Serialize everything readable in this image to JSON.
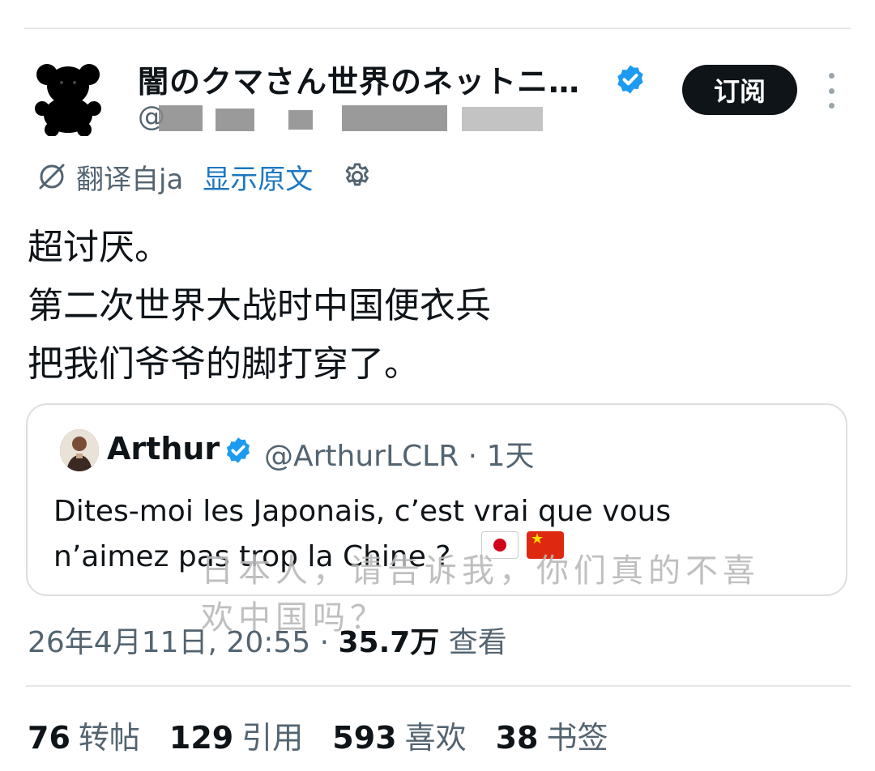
{
  "author": {
    "display_name": "闇のクマさん世界のネットニ…",
    "handle": "@",
    "subscribe_label": "订阅"
  },
  "translation": {
    "label": "翻译自ja",
    "show_original": "显示原文"
  },
  "post": {
    "text": "超讨厌。\n第二次世界大战时中国便衣兵\n把我们爷爷的脚打穿了。"
  },
  "quote": {
    "name": "Arthur",
    "meta": "@ArthurLCLR · 1天",
    "text": "Dites-moi les Japonais, c’est vrai que vous\nn’aimez pas trop la Chine ?"
  },
  "subtitle_overlay": "日本人，请告诉我，你们真的不喜\n欢中国吗？",
  "timestamp": {
    "datetime": "26年4月11日, 20:55 · ",
    "views_value": "35.7万",
    "views_label": " 查看"
  },
  "stats": [
    {
      "value": "76",
      "label": "转帖"
    },
    {
      "value": "129",
      "label": "引用"
    },
    {
      "value": "593",
      "label": "喜欢"
    },
    {
      "value": "38",
      "label": "书签"
    }
  ],
  "colors": {
    "verified": "#1d9bf0",
    "link": "#1d78c1",
    "button_bg": "#0f1419"
  }
}
